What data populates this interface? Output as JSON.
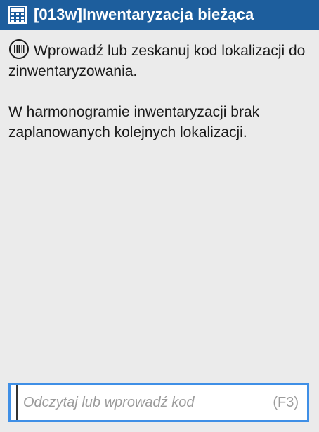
{
  "window": {
    "title": "[013w]Inwentaryzacja bieżąca",
    "title_icon": "calculator-icon",
    "accent_color": "#1d5e9d"
  },
  "main": {
    "instruction_icon": "barcode-icon",
    "instruction_text": "Wprowadź lub zeskanuj kod lokalizacji do zinwentaryzowania.",
    "info_text": "W harmonogramie inwentaryzacji brak zaplanowanych kolejnych lokalizacji."
  },
  "scan_input": {
    "value": "",
    "placeholder": "Odczytaj lub wprowadź kod",
    "shortcut": "(F3)",
    "focus_color": "#3f8fe6"
  }
}
